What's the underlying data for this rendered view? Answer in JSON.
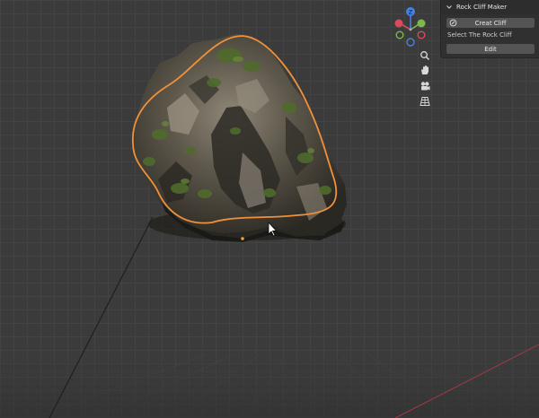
{
  "panel": {
    "title": "Rock Cliff Maker",
    "create_label": "Creat Cliff",
    "select_text": "Select The Rock Cliff",
    "edit_label": "Edit"
  },
  "gizmo": {
    "colors": {
      "x": "#d94b5a",
      "y": "#7cb94a",
      "z": "#4a7fe0"
    },
    "axis_labels": {
      "z": "Z"
    }
  },
  "viewport_tools": [
    "zoom-icon",
    "hand-pan-icon",
    "camera-icon",
    "grid-view-icon"
  ],
  "colors": {
    "selection_outline": "#f0913a",
    "rock_dark": "#2b2b22",
    "rock_light": "#8a8375",
    "moss": "#4f6b2c"
  }
}
